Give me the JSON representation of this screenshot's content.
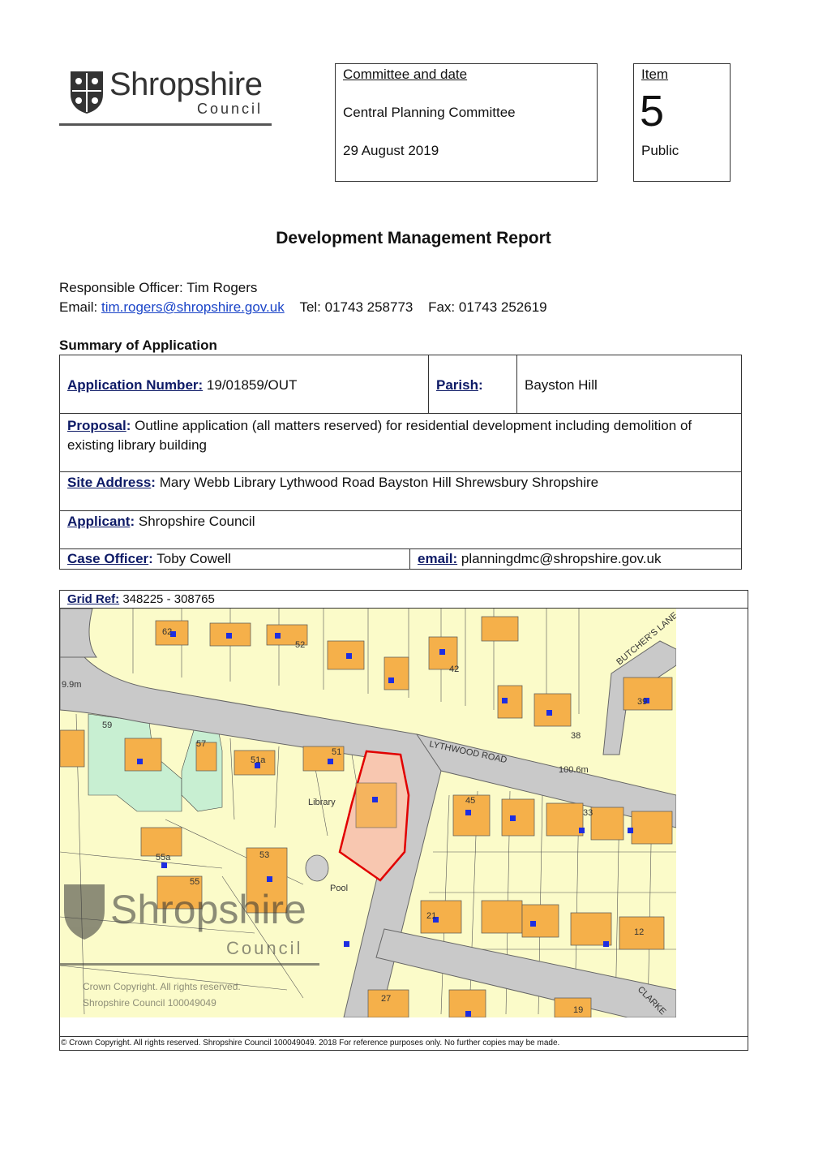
{
  "logo": {
    "name": "Shropshire",
    "council": "Council"
  },
  "committee": {
    "header": "Committee and date",
    "name": "Central Planning Committee",
    "date": "29 August 2019"
  },
  "item": {
    "header": "Item",
    "number": "5",
    "status": "Public"
  },
  "title": "Development Management Report",
  "officer": {
    "label": "Responsible Officer:",
    "name": "Tim Rogers",
    "email_label": "Email:",
    "email": "tim.rogers@shropshire.gov.uk",
    "tel": "Tel: 01743 258773",
    "fax": "Fax: 01743 252619"
  },
  "summary": {
    "heading": "Summary of Application",
    "app_number_label": "Application Number:",
    "app_number": "19/01859/OUT",
    "parish_label": "Parish",
    "parish": "Bayston Hill",
    "proposal_label": "Proposal",
    "proposal": "Outline application (all matters reserved) for residential development including demolition of existing library building",
    "site_label": "Site Address",
    "site": "Mary Webb Library Lythwood Road Bayston Hill Shrewsbury Shropshire",
    "applicant_label": "Applicant",
    "applicant": "Shropshire Council",
    "case_officer_label": "Case Officer",
    "case_officer": "Toby Cowell",
    "email_label": "email:",
    "email": "planningdmc@shropshire.gov.uk"
  },
  "map": {
    "grid_ref_label": "Grid Ref:",
    "grid_ref": "348225 - 308765",
    "labels": {
      "road": "LYTHWOOD ROAD",
      "height1": "100.6m",
      "height2": "9.9m",
      "library": "Library",
      "pool": "Pool",
      "lane": "BUTCHER'S LANE",
      "clarke": "CLARKE",
      "n62": "62",
      "n52": "52",
      "n42": "42",
      "n39": "39",
      "n38": "38",
      "n59": "59",
      "n57": "57",
      "n51a": "51a",
      "n51": "51",
      "n45": "45",
      "n33": "33",
      "n55a": "55a",
      "n53": "53",
      "n55": "55",
      "n21": "21",
      "n12": "12",
      "n27": "27",
      "n19": "19"
    },
    "watermark_name": "Shropshire",
    "watermark_council": "Council",
    "copyright_line1": "Crown Copyright. All rights reserved.",
    "copyright_line2": "Shropshire Council 100049049",
    "footer": "© Crown Copyright. All rights reserved.  Shropshire Council 100049049. 2018  For reference purposes only. No further copies may be made."
  }
}
